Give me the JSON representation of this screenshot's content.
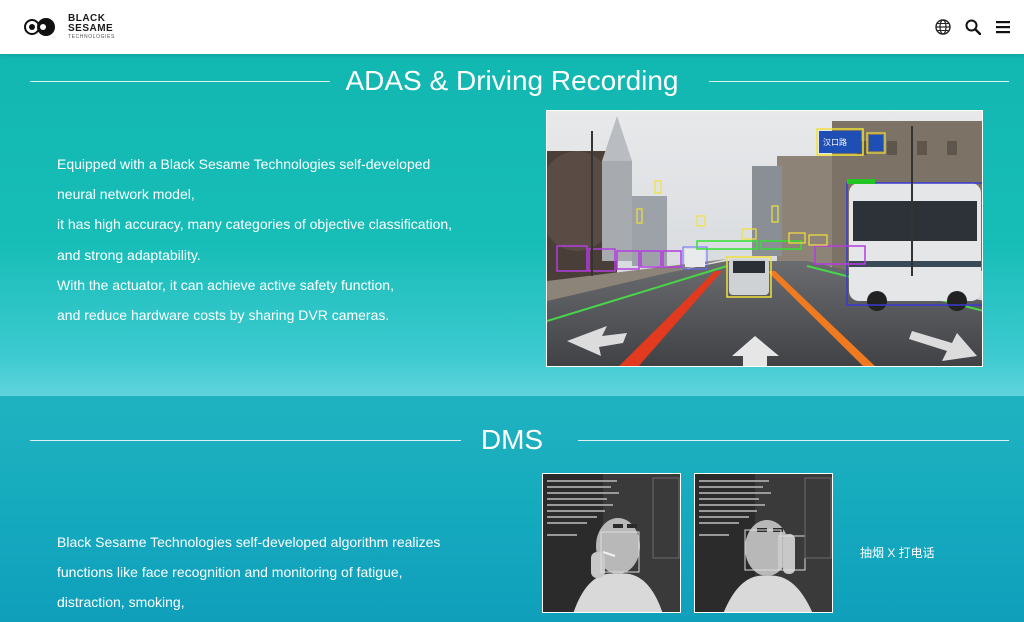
{
  "header": {
    "logo": {
      "line1": "BLACK",
      "line2": "SESAME",
      "line3": "TECHNOLOGIES"
    },
    "icons": [
      "globe-icon",
      "search-icon",
      "menu-icon"
    ]
  },
  "adas": {
    "title": "ADAS & Driving Recording",
    "lines": [
      "Equipped with a Black Sesame Technologies self-developed",
      "neural network model,",
      "it has high accuracy, many categories of objective classification,",
      "and strong adaptability.",
      "With the actuator, it can achieve active safety function,",
      "and reduce hardware costs by sharing DVR cameras."
    ],
    "image_labels": [
      "汉口路"
    ]
  },
  "dms": {
    "title": "DMS",
    "lines": [
      "Black Sesame Technologies self-developed algorithm realizes",
      "functions like face recognition and monitoring of fatigue,",
      "distraction, smoking,"
    ],
    "caption": "抽烟 X 打电话"
  },
  "colors": {
    "teal": "#18b6b8",
    "header_bg": "#ffffff",
    "text": "#ffffff"
  }
}
